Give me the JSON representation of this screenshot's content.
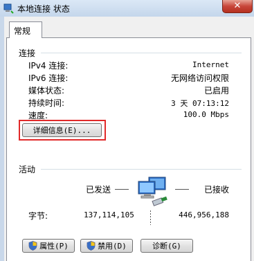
{
  "window": {
    "title": "本地连接 状态",
    "close_glyph": "✕"
  },
  "tab": {
    "label": "常规"
  },
  "connection": {
    "header": "连接",
    "rows": [
      {
        "label": "IPv4 连接:",
        "value": "Internet"
      },
      {
        "label": "IPv6 连接:",
        "value": "无网络访问权限"
      },
      {
        "label": "媒体状态:",
        "value": "已启用"
      },
      {
        "label": "持续时间:",
        "value": "3 天 07:13:12"
      },
      {
        "label": "速度:",
        "value": "100.0 Mbps"
      }
    ],
    "details_button": "详细信息(E)..."
  },
  "activity": {
    "header": "活动",
    "sent_label": "已发送",
    "received_label": "已接收",
    "bytes_label": "字节:",
    "sent_value": "137,114,105",
    "received_value": "446,956,188"
  },
  "buttons": {
    "properties": "属性(P)",
    "disable": "禁用(D)",
    "diagnose": "诊断(G)"
  },
  "colors": {
    "highlight": "#e12a2a",
    "close": "#c8463a"
  },
  "icons": [
    "network-icon",
    "network-computers-icon",
    "shield-icon"
  ]
}
